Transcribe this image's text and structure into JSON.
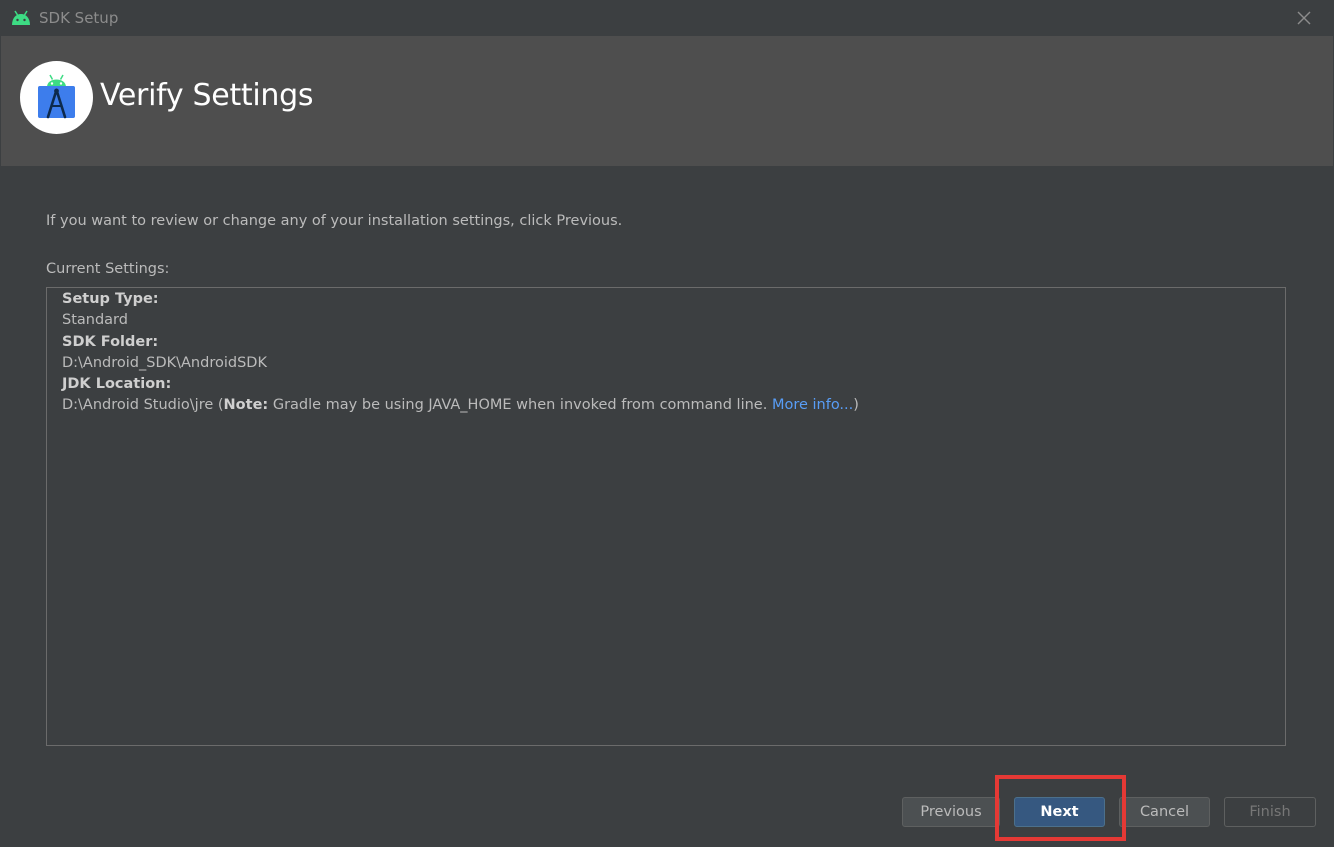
{
  "window": {
    "title": "SDK Setup",
    "title_icon": "android-icon",
    "close_icon": "close-icon"
  },
  "header": {
    "title": "Verify Settings",
    "logo_icon": "android-studio-logo-icon"
  },
  "intro_text": "If you want to review or change any of your installation settings, click Previous.",
  "current_settings_label": "Current Settings:",
  "settings": {
    "setup_type_label": "Setup Type:",
    "setup_type_value": "Standard",
    "sdk_folder_label": "SDK Folder:",
    "sdk_folder_value": "D:\\Android_SDK\\AndroidSDK",
    "jdk_location_label": "JDK Location:",
    "jdk_location_path": "D:\\Android Studio\\jre (",
    "jdk_note_label": "Note:",
    "jdk_note_text": " Gradle may be using JAVA_HOME when invoked from command line. ",
    "jdk_more_info_link": "More info...",
    "jdk_close_paren": ")"
  },
  "buttons": {
    "previous": "Previous",
    "next": "Next",
    "cancel": "Cancel",
    "finish": "Finish"
  },
  "colors": {
    "background": "#3c3f41",
    "header_background": "#4e4e4e",
    "link": "#589df6",
    "primary_button": "#365880",
    "highlight_box": "#e53935",
    "android_green": "#3ddc84"
  }
}
